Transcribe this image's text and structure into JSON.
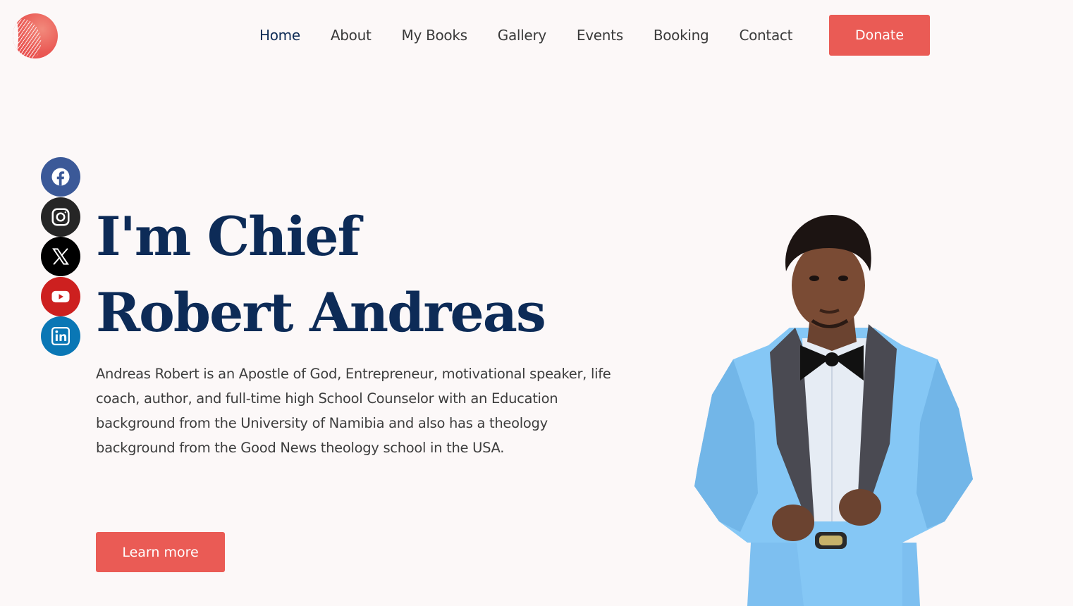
{
  "nav": {
    "items": [
      {
        "label": "Home",
        "active": true
      },
      {
        "label": "About"
      },
      {
        "label": "My Books"
      },
      {
        "label": "Gallery"
      },
      {
        "label": "Events"
      },
      {
        "label": "Booking"
      },
      {
        "label": "Contact"
      }
    ],
    "donate_label": "Donate"
  },
  "social": [
    "facebook-icon",
    "instagram-icon",
    "x-icon",
    "youtube-icon",
    "linkedin-icon"
  ],
  "hero": {
    "title_line1": "I'm Chief",
    "title_line2": "Robert Andreas",
    "bio": "Andreas Robert is an Apostle of God, Entrepreneur, motivational speaker, life coach, author, and full-time high School Counselor with an Education background from the University of Namibia and also has a theology background from the Good News theology school in the USA.",
    "cta_label": "Learn more"
  },
  "colors": {
    "accent": "#ea5b55",
    "heading": "#0d2b57",
    "background": "#fcf8f8"
  }
}
